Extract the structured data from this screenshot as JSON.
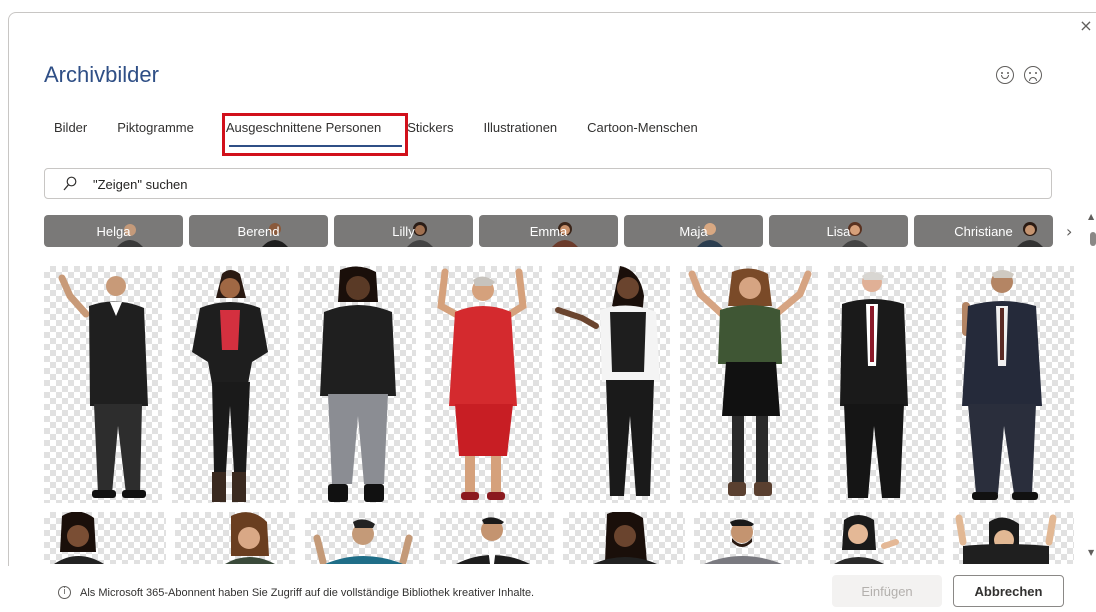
{
  "dialog": {
    "title": "Archivbilder",
    "close_glyph": "×",
    "icons": [
      "smile-icon",
      "frown-icon",
      "close-icon",
      "search-icon",
      "info-icon",
      "chevron-right-icon"
    ]
  },
  "tabs": [
    {
      "label": "Bilder",
      "active": false
    },
    {
      "label": "Piktogramme",
      "active": false
    },
    {
      "label": "Ausgeschnittene Personen",
      "active": true
    },
    {
      "label": "Stickers",
      "active": false
    },
    {
      "label": "Illustrationen",
      "active": false
    },
    {
      "label": "Cartoon-Menschen",
      "active": false
    }
  ],
  "search": {
    "placeholder": "\"Zeigen\" suchen",
    "value": ""
  },
  "chips": [
    {
      "label": "Helga"
    },
    {
      "label": "Berend"
    },
    {
      "label": "Lilly"
    },
    {
      "label": "Emma"
    },
    {
      "label": "Maja"
    },
    {
      "label": "Lisa"
    },
    {
      "label": "Christiane"
    }
  ],
  "chips_next_glyph": "›",
  "footer": {
    "info_glyph": "i",
    "notice": "Als Microsoft 365-Abonnent haben Sie Zugriff auf die vollständige Bibliothek kreativer Inhalte.",
    "insert_label": "Einfügen",
    "cancel_label": "Abbrechen"
  },
  "colors": {
    "title": "#2f4f86",
    "tab_underline": "#2f4f86",
    "highlight_box": "#d1101b",
    "chip_bg": "#7a7978"
  }
}
